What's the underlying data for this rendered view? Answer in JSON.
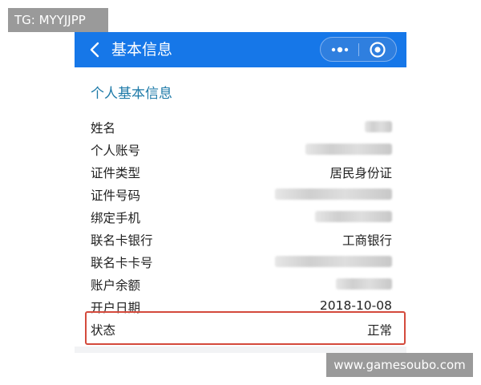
{
  "watermarks": {
    "top_left": "TG: MYYJJPP",
    "bottom_right": "www.gamesoubo.com"
  },
  "navbar": {
    "title": "基本信息",
    "back_icon": "chevron-left-icon",
    "menu_icon": "more-dots-icon",
    "close_icon": "record-circle-icon",
    "color": "#1677e8"
  },
  "section": {
    "title": "个人基本信息",
    "title_color": "#1e7aa8"
  },
  "fields": [
    {
      "label": "姓名",
      "value": "",
      "masked": true
    },
    {
      "label": "个人账号",
      "value": "",
      "masked": true
    },
    {
      "label": "证件类型",
      "value": "居民身份证",
      "masked": false
    },
    {
      "label": "证件号码",
      "value": "",
      "masked": true
    },
    {
      "label": "绑定手机",
      "value": "",
      "masked": true
    },
    {
      "label": "联名卡银行",
      "value": "工商银行",
      "masked": false
    },
    {
      "label": "联名卡卡号",
      "value": "",
      "masked": true
    },
    {
      "label": "账户余额",
      "value": "",
      "masked": true
    },
    {
      "label": "开户日期",
      "value": "2018-10-08",
      "masked": false
    },
    {
      "label": "状态",
      "value": "正常",
      "masked": false
    }
  ],
  "highlight_color": "#d44a3c"
}
